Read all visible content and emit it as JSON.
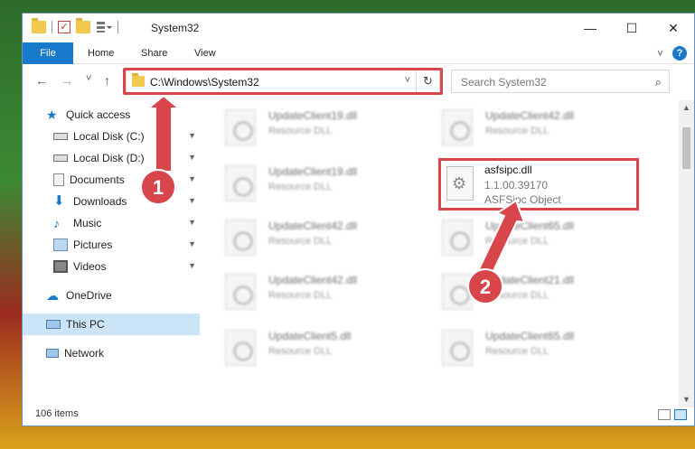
{
  "window": {
    "title": "System32",
    "controls": {
      "minimize": "—",
      "maximize": "☐",
      "close": "✕"
    }
  },
  "ribbon": {
    "tabs": [
      "File",
      "Home",
      "Share",
      "View"
    ],
    "collapse": "˅",
    "help": "?"
  },
  "nav": {
    "back": "←",
    "forward": "→",
    "recent": "˅",
    "up": "↑",
    "address": "C:\\Windows\\System32",
    "refresh": "↻",
    "search_placeholder": "Search System32",
    "search_icon": "⌕"
  },
  "sidebar": {
    "items": [
      {
        "label": "Quick access",
        "icon": "star-icon",
        "pinned": false
      },
      {
        "label": "Local Disk (C:)",
        "icon": "drive-icon",
        "pinned": true
      },
      {
        "label": "Local Disk (D:)",
        "icon": "drive-icon",
        "pinned": true
      },
      {
        "label": "Documents",
        "icon": "documents-icon",
        "pinned": true
      },
      {
        "label": "Downloads",
        "icon": "download-icon",
        "pinned": true
      },
      {
        "label": "Music",
        "icon": "music-icon",
        "pinned": true
      },
      {
        "label": "Pictures",
        "icon": "pictures-icon",
        "pinned": true
      },
      {
        "label": "Videos",
        "icon": "videos-icon",
        "pinned": true
      },
      {
        "label": "OneDrive",
        "icon": "cloud-icon",
        "pinned": false
      },
      {
        "label": "This PC",
        "icon": "computer-icon",
        "pinned": false,
        "selected": true
      },
      {
        "label": "Network",
        "icon": "network-icon",
        "pinned": false
      }
    ],
    "pin_glyph": "📌"
  },
  "files": [
    {
      "name": "UpdateClient19.dll",
      "desc": "Resource DLL"
    },
    {
      "name": "UpdateClient42.dll",
      "desc": "Resource DLL"
    },
    {
      "name": "UpdateClient19.dll",
      "desc": "Resource DLL"
    },
    {
      "name": "UpdateClient42.dll",
      "desc": "Resource DLL"
    },
    {
      "name": "UpdateClient65.dll",
      "desc": "Resource DLL"
    },
    {
      "name": "UpdateClient42.dll",
      "desc": "Resource DLL"
    },
    {
      "name": "UpdateClient21.dll",
      "desc": "Resource DLL"
    },
    {
      "name": "UpdateClient5.dll",
      "desc": "Resource DLL"
    },
    {
      "name": "UpdateClient65.dll",
      "desc": "Resource DLL"
    }
  ],
  "highlighted_file": {
    "name": "asfsipc.dll",
    "version": "1.1.00.39170",
    "description": "ASFSipc Object"
  },
  "status": {
    "count": "106 items"
  },
  "annotations": {
    "step1": "1",
    "step2": "2",
    "color": "#d8454a"
  }
}
